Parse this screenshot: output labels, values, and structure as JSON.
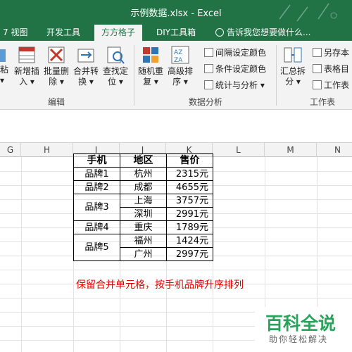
{
  "window": {
    "title": "示例数据.xlsx - Excel"
  },
  "tabs": [
    {
      "label": "7 视图"
    },
    {
      "label": "开发工具"
    },
    {
      "label": "方方格子"
    },
    {
      "label": "DIY工具箱"
    }
  ],
  "tell_me": {
    "placeholder": "告诉我您想要做什么..."
  },
  "ribbon": {
    "left_cut_1": "粘",
    "left_cut_2": "▾",
    "buttons": {
      "batch_add": {
        "line1": "新增插",
        "line2": "入 ▾"
      },
      "batch_delete": {
        "line1": "批量删",
        "line2": "除 ▾"
      },
      "merge_convert": {
        "line1": "合并转",
        "line2": "换 ▾"
      },
      "find_locate": {
        "line1": "查找定",
        "line2": "位 ▾"
      },
      "random_repeat": {
        "line1": "随机重",
        "line2": "复 ▾"
      },
      "advanced_sort": {
        "line1": "高级排",
        "line2": "序 ▾"
      },
      "summary_split": {
        "line1": "汇总拆",
        "line2": "分 ▾"
      }
    },
    "small": {
      "interval_color": "间隔设定颜色",
      "conditional_color": "条件设定颜色",
      "stat_analysis": "统计与分析 ▾",
      "save_as": "另存本",
      "table_dir": "表格目",
      "worksheet": "工作表"
    },
    "groups": {
      "edit": "编辑",
      "data_analysis": "数据分析",
      "worksheet": "工作表"
    }
  },
  "columns": [
    "G",
    "H",
    "I",
    "J",
    "K",
    "L",
    "M",
    "N"
  ],
  "table": {
    "headers": [
      "手机",
      "地区",
      "售价"
    ],
    "rows": [
      {
        "brand": "品牌1",
        "region": "杭州",
        "price": "2315元"
      },
      {
        "brand": "品牌2",
        "region": "成都",
        "price": "4655元"
      },
      {
        "brand": "品牌3",
        "region": "上海",
        "price": "3757元"
      },
      {
        "brand": "",
        "region": "深圳",
        "price": "2991元"
      },
      {
        "brand": "品牌4",
        "region": "重庆",
        "price": "1789元"
      },
      {
        "brand": "品牌5",
        "region": "福州",
        "price": "1424元"
      },
      {
        "brand": "",
        "region": "广州",
        "price": "2997元"
      }
    ]
  },
  "note": "保留合并单元格，按手机品牌升序排列",
  "watermark": {
    "title": "百科全说",
    "subtitle": "助你轻松解决"
  },
  "colors": {
    "excel_green": "#217346",
    "note_red": "#e00000",
    "watermark_green": "#27a35a"
  }
}
